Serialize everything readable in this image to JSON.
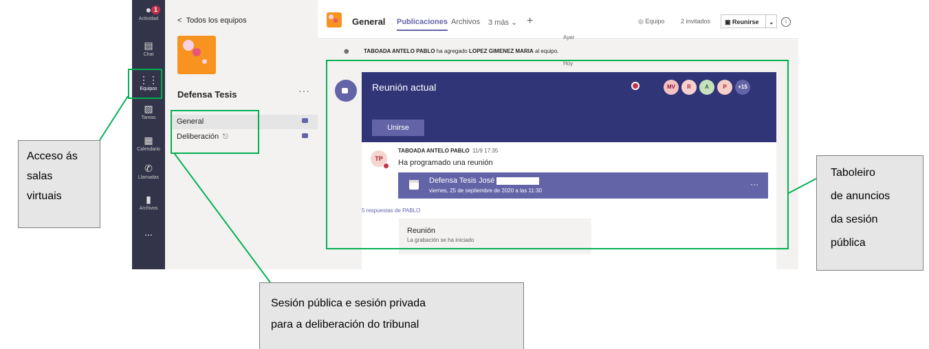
{
  "rail": {
    "items": [
      {
        "label": "Actividad",
        "icon": "bell-icon",
        "badge": "1"
      },
      {
        "label": "Chat",
        "icon": "chat-icon"
      },
      {
        "label": "Equipos",
        "icon": "teams-icon"
      },
      {
        "label": "Tareas",
        "icon": "tasks-icon"
      },
      {
        "label": "Calendario",
        "icon": "calendar-icon"
      },
      {
        "label": "Llamadas",
        "icon": "phone-icon"
      },
      {
        "label": "Archivos",
        "icon": "files-icon"
      },
      {
        "label": "...",
        "icon": "more-icon"
      }
    ]
  },
  "teams_pane": {
    "back_label": "Todos los equipos",
    "team_name": "Defensa Tesis",
    "more": "···",
    "channels": [
      {
        "name": "General"
      },
      {
        "name": "Deliberación"
      }
    ]
  },
  "header": {
    "channel": "General",
    "tabs": [
      "Publicaciones",
      "Archivos",
      "3 más"
    ],
    "add": "+",
    "team_btn": "Equipo",
    "guests_btn": "2 invitados",
    "meet_btn": "Reunirse"
  },
  "feed": {
    "date_yesterday": "Ayer",
    "system_msg_name1": "TABOADA ANTELO PABLO",
    "system_msg_mid": "ha agregado",
    "system_msg_name2": "LOPEZ GIMENEZ MARIA",
    "system_msg_end": "al equipo.",
    "date_today": "Hoy",
    "meeting_title": "Reunión actual",
    "join_label": "Unirse",
    "participants": [
      {
        "initials": "MV",
        "color": "#f4c2c2",
        "fg": "#8a1538"
      },
      {
        "initials": "R",
        "color": "#f8d0d0",
        "fg": "#a4262c"
      },
      {
        "initials": "A",
        "color": "#c7e0c0",
        "fg": "#2d6b24"
      },
      {
        "initials": "P",
        "color": "#f6cfc8",
        "fg": "#a4262c"
      }
    ],
    "more_participants": "+15",
    "post_author": "TABOADA ANTELO PABLO",
    "post_time": "11/9 17:35",
    "post_avatar": "TP",
    "post_text": "Ha programado una reunión",
    "event_title": "Defensa Tesis José",
    "event_date": "viernes, 25 de septiembre de 2020 a las 11:30",
    "event_more": "···",
    "replies_link": "5 respuestas de PABLO",
    "reply_title": "Reunión",
    "reply_sub": "La grabación se ha iniciado"
  },
  "annotations": {
    "left": [
      "Acceso ás",
      "salas",
      "virtuais"
    ],
    "bottom": [
      "Sesión pública e sesión privada",
      "para a deliberación do tribunal"
    ],
    "right": [
      "Taboleiro",
      "de anuncios",
      "da sesión",
      "pública"
    ]
  },
  "colors": {
    "rail": "#33344a",
    "accent": "#6264a7",
    "meeting_banner": "#2f3577",
    "annotation_green": "#00b050"
  }
}
